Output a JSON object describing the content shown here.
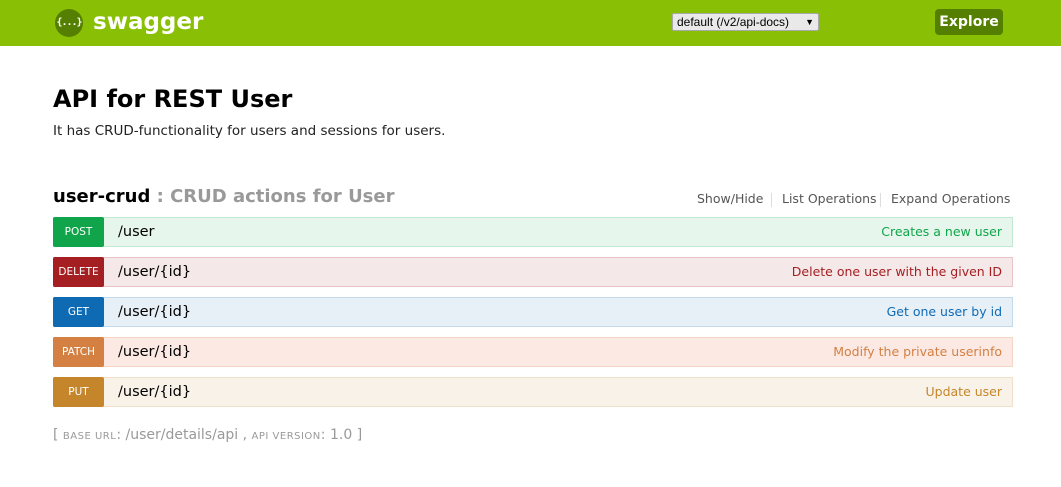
{
  "header": {
    "logo_glyph": "{...}",
    "brand": "swagger",
    "spec_select": "default (/v2/api-docs)",
    "spec_arrow": "▼",
    "explore_label": "Explore",
    "bg_color": "#89bf04"
  },
  "info": {
    "title": "API for REST User",
    "description": "It has CRUD-functionality for users and sessions for users."
  },
  "resource": {
    "name": "user-crud",
    "description": " : CRUD actions for User",
    "links": [
      "Show/Hide",
      "List Operations",
      "Expand Operations"
    ]
  },
  "operations": [
    {
      "method": "POST",
      "path": "/user",
      "summary": "Creates a new user",
      "color": "#10a54a"
    },
    {
      "method": "DELETE",
      "path": "/user/{id}",
      "summary": "Delete one user with the given ID",
      "color": "#a41e22"
    },
    {
      "method": "GET",
      "path": "/user/{id}",
      "summary": "Get one user by id",
      "color": "#0f6ab4"
    },
    {
      "method": "PATCH",
      "path": "/user/{id}",
      "summary": "Modify the private userinfo",
      "color": "#d38042"
    },
    {
      "method": "PUT",
      "path": "/user/{id}",
      "summary": "Update user",
      "color": "#c5862b"
    }
  ],
  "footer": {
    "open_bracket": "[",
    "base_url_label": "base url",
    "base_url": "/user/details/api",
    "separator": ",",
    "api_version_label": "api version",
    "api_version": "1.0",
    "close_bracket": "]"
  }
}
